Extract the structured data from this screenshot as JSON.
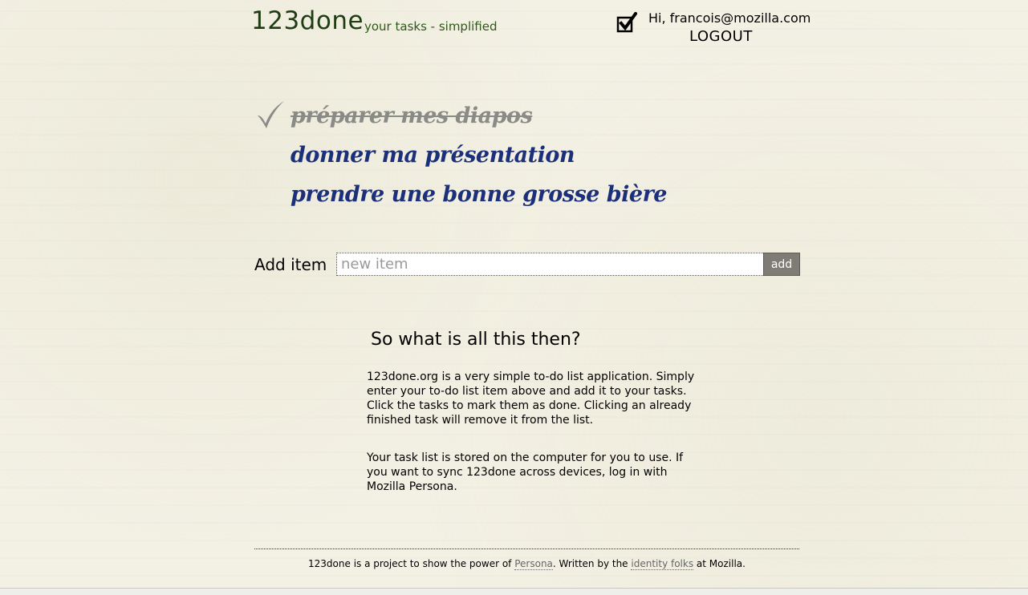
{
  "header": {
    "brand": "123done",
    "tagline": "your tasks - simplified",
    "user_icon": "checkbox-checked-icon",
    "greeting": "Hi, francois@mozilla.com",
    "logout_label": "LOGOUT"
  },
  "tasks": [
    {
      "label": "préparer mes diapos",
      "done": true,
      "icon": "checkmark-icon"
    },
    {
      "label": "donner ma présentation",
      "done": false
    },
    {
      "label": "prendre une bonne grosse bière",
      "done": false
    }
  ],
  "add_item": {
    "label": "Add item",
    "placeholder": "new item",
    "value": "",
    "button_label": "add"
  },
  "about": {
    "heading": "So what is all this then?",
    "paragraph1": "123done.org is a very simple to-do list application. Simply enter your to-do list item above and add it to your tasks. Click the tasks to mark them as done. Clicking an already finished task will remove it from the list.",
    "paragraph2": "Your task list is stored on the computer for you to use. If you want to sync 123done across devices, log in with Mozilla Persona."
  },
  "footer": {
    "prefix": "123done is a project to show the power of ",
    "persona_link": "Persona",
    "middle": ". Written by the ",
    "identity_link": "identity folks",
    "suffix": " at Mozilla."
  },
  "colors": {
    "background": "#f3f1e4",
    "brand": "#1f3d12",
    "tagline": "#2d5a16",
    "task": "#1b2f7a",
    "task_done": "#8a8a86",
    "add_button": "#7f7c75"
  }
}
